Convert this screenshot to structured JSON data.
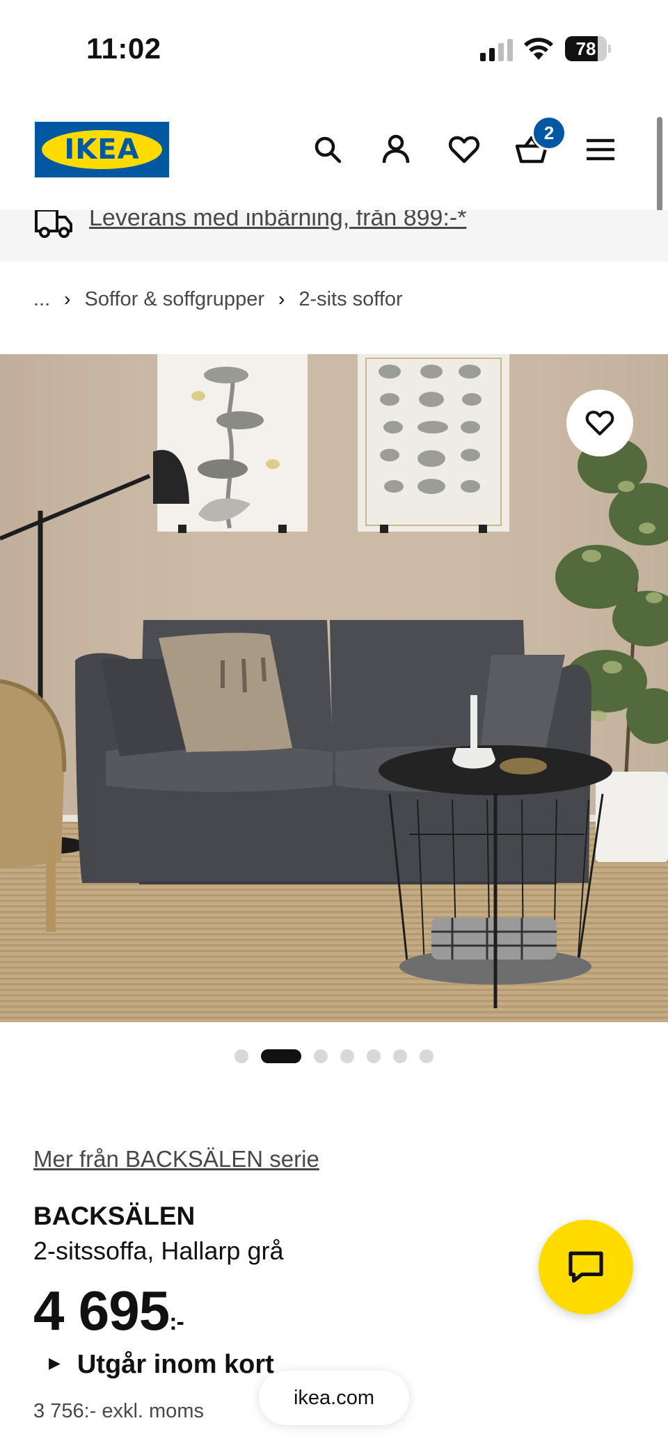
{
  "status_bar": {
    "time": "11:02",
    "battery": "78",
    "battery_level": 0.78
  },
  "header": {
    "logo": "IKEA",
    "cart_count": "2",
    "icons": [
      "search-icon",
      "account-icon",
      "heart-icon",
      "cart-icon",
      "menu-icon"
    ]
  },
  "delivery": {
    "text": "Leverans med inbärning, från 899:-*"
  },
  "breadcrumb": {
    "ellipsis": "...",
    "items": [
      "Soffor & soffgrupper",
      "2-sits soffor"
    ]
  },
  "carousel": {
    "total": 7,
    "active_index": 1
  },
  "product": {
    "series_link": "Mer från BACKSÄLEN serie",
    "name": "BACKSÄLEN",
    "description": "2-sitssoffa, Hallarp grå",
    "price": "4 695",
    "price_suffix": ":-",
    "availability": "Utgår inom kort",
    "excl_vat": "3 756:- exkl. moms"
  },
  "browser": {
    "url": "ikea.com"
  },
  "colors": {
    "ikea_blue": "#0058a3",
    "ikea_yellow": "#ffdb00",
    "text_primary": "#111111",
    "text_secondary": "#484848"
  }
}
